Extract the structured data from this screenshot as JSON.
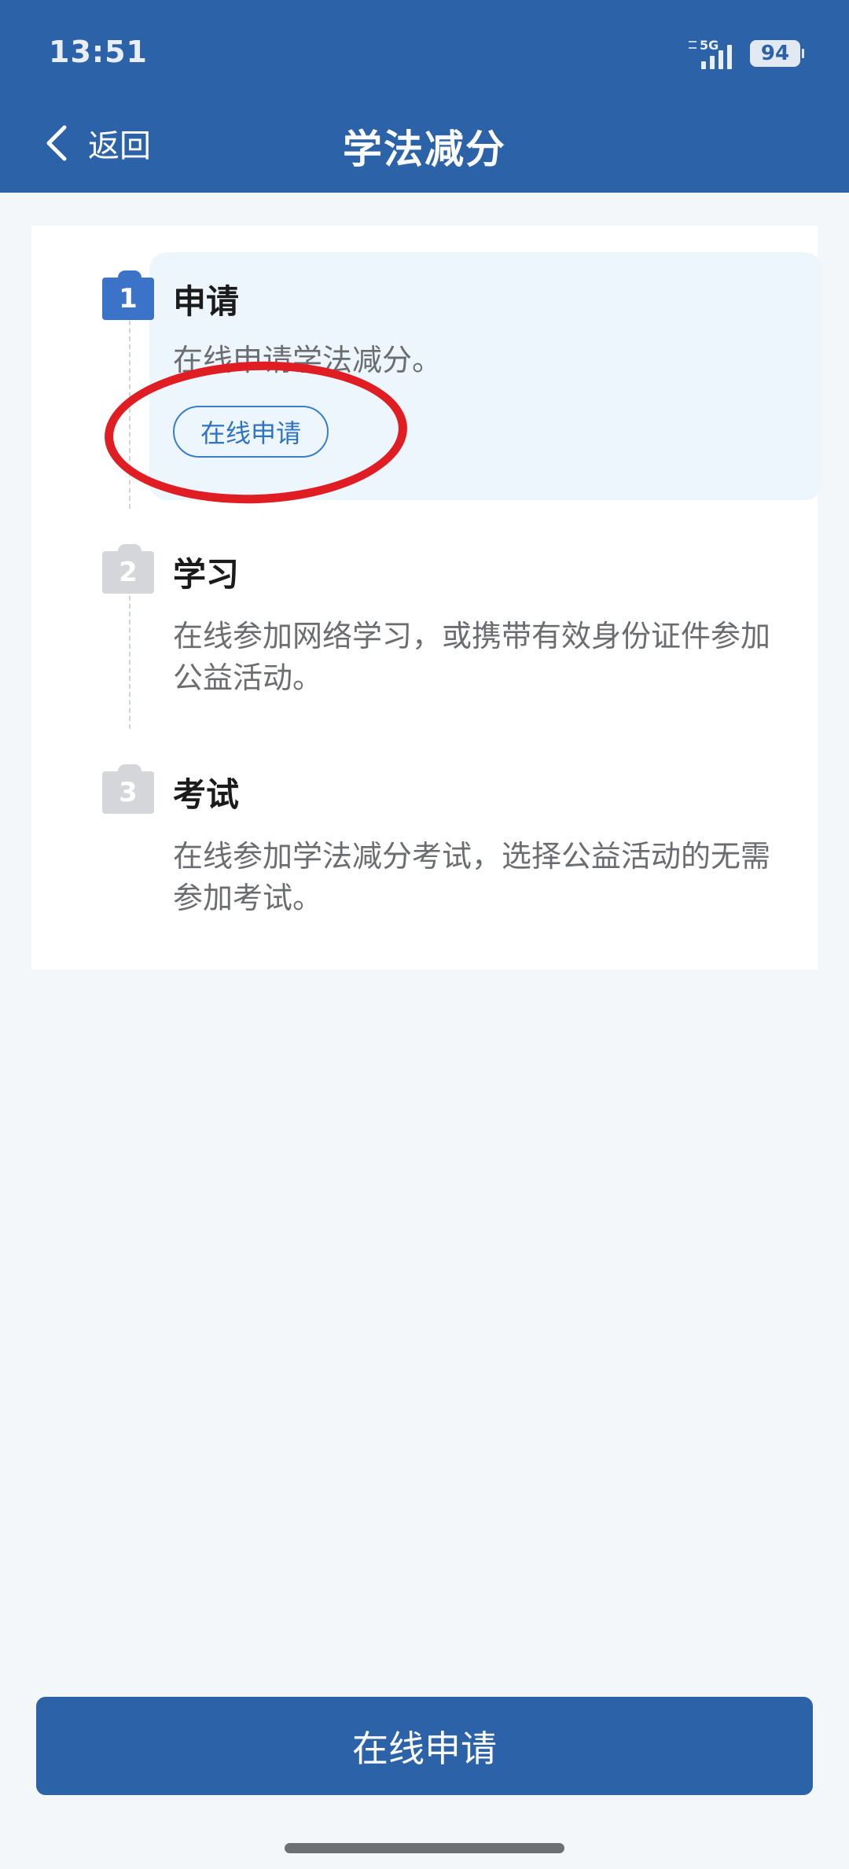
{
  "status_bar": {
    "time": "13:51",
    "network": "5G",
    "battery": "94"
  },
  "nav": {
    "back_label": "返回",
    "title": "学法减分"
  },
  "steps": [
    {
      "number": "1",
      "title": "申请",
      "desc": "在线申请学法减分。",
      "button_label": "在线申请",
      "active": true
    },
    {
      "number": "2",
      "title": "学习",
      "desc": "在线参加网络学习，或携带有效身份证件参加公益活动。",
      "active": false
    },
    {
      "number": "3",
      "title": "考试",
      "desc": "在线参加学法减分考试，选择公益活动的无需参加考试。",
      "active": false
    }
  ],
  "primary_action": {
    "label": "在线申请"
  },
  "colors": {
    "header_bg": "#2c62a7",
    "active_badge": "#3b73c9",
    "inactive_badge": "#d4d6d9",
    "highlight_bg": "#eef6fd",
    "annotation_red": "#e01d22"
  },
  "icons": {
    "back": "chevron-left-icon",
    "signal": "signal-icon",
    "battery": "battery-icon"
  }
}
